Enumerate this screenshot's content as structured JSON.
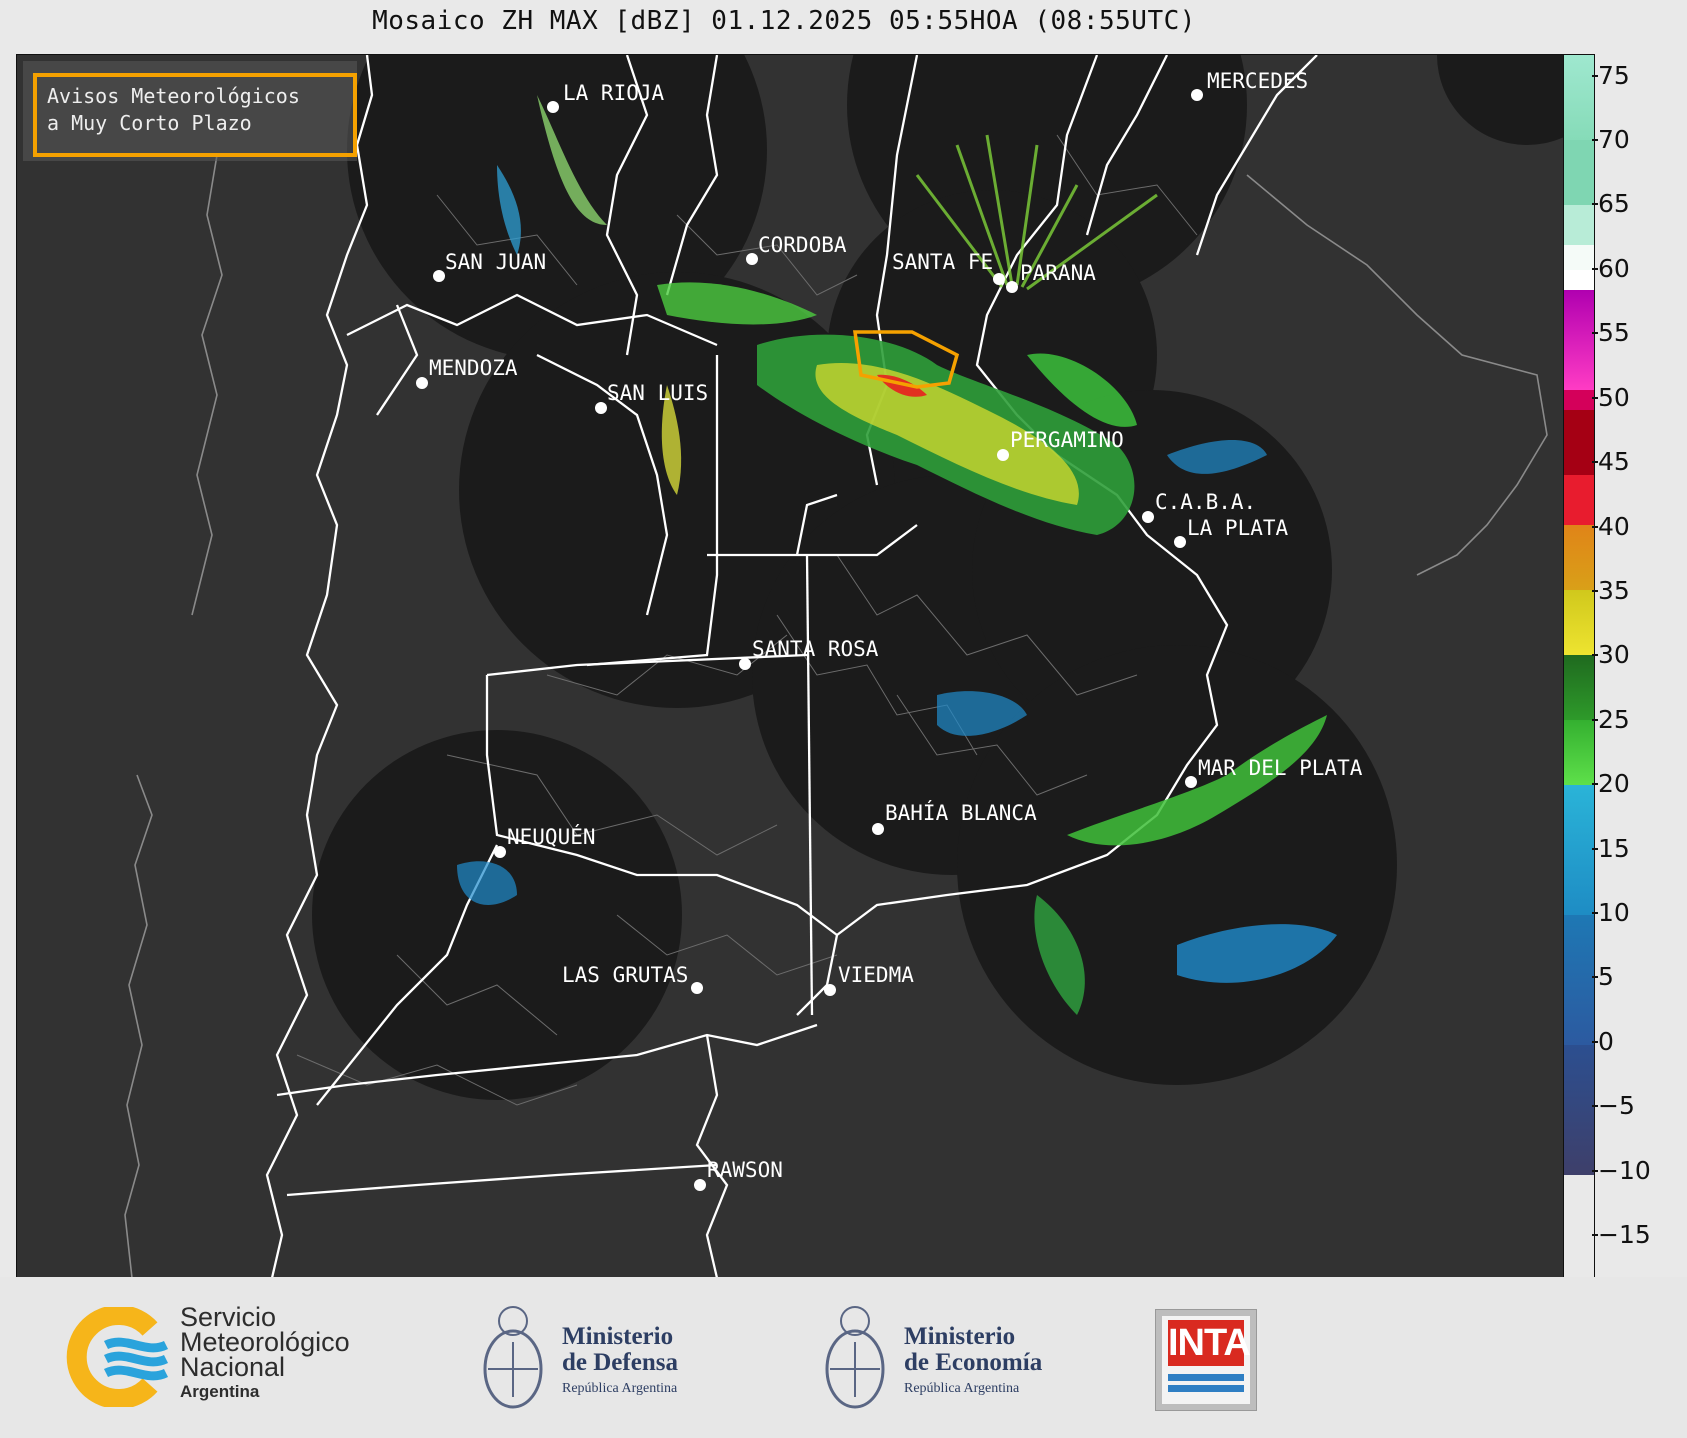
{
  "title": "Mosaico ZH MAX [dBZ] 01.12.2025 05:55HOA (08:55UTC)",
  "warning_box": {
    "text": "Avisos Meteorológicos\na Muy Corto Plazo",
    "border_color": "#f5a100"
  },
  "cities": [
    {
      "name": "LA RIOJA"
    },
    {
      "name": "MERCEDES"
    },
    {
      "name": "CORDOBA"
    },
    {
      "name": "SAN JUAN"
    },
    {
      "name": "SANTA FE"
    },
    {
      "name": "PARANA"
    },
    {
      "name": "MENDOZA"
    },
    {
      "name": "SAN LUIS"
    },
    {
      "name": "PERGAMINO"
    },
    {
      "name": "C.A.B.A."
    },
    {
      "name": "LA PLATA"
    },
    {
      "name": "SANTA ROSA"
    },
    {
      "name": "MAR DEL PLATA"
    },
    {
      "name": "NEUQUÉN"
    },
    {
      "name": "BAHÍA BLANCA"
    },
    {
      "name": "LAS GRUTAS"
    },
    {
      "name": "VIEDMA"
    },
    {
      "name": "RAWSON"
    }
  ],
  "colorbar": {
    "unit": "dBZ",
    "range": [
      -19,
      77
    ],
    "ticks": [
      "75",
      "70",
      "65",
      "60",
      "55",
      "50",
      "45",
      "40",
      "35",
      "30",
      "25",
      "20",
      "15",
      "10",
      "5",
      "0",
      "−5",
      "−10",
      "−15"
    ]
  },
  "logos": {
    "smn_line1": "Servicio",
    "smn_line2": "Meteorológico",
    "smn_line3": "Nacional",
    "smn_sub": "Argentina",
    "defensa_line1": "Ministerio",
    "defensa_line2": "de Defensa",
    "defensa_sub": "República Argentina",
    "economia_line1": "Ministerio",
    "economia_line2": "de Economía",
    "economia_sub": "República Argentina",
    "inta": "INTA"
  }
}
